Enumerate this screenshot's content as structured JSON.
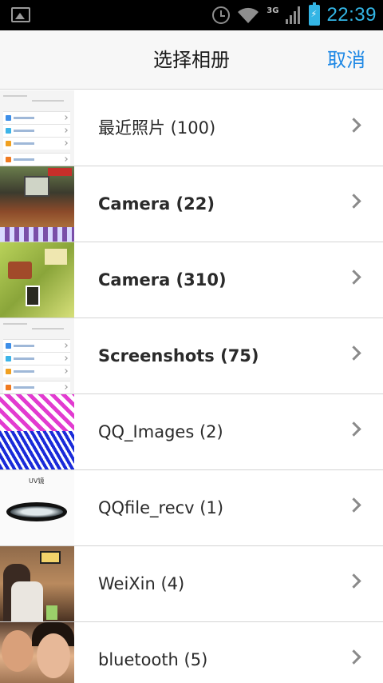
{
  "status_bar": {
    "network_type": "3G",
    "time": "22:39"
  },
  "header": {
    "title": "选择相册",
    "cancel_label": "取消"
  },
  "albums": [
    {
      "label": "最近照片 (100)",
      "thumbnail": "screenshot-thumbnail"
    },
    {
      "label": "Camera (22)",
      "thumbnail": "camera-photo-thumbnail"
    },
    {
      "label": "Camera (310)",
      "thumbnail": "camera-photo-thumbnail"
    },
    {
      "label": "Screenshots (75)",
      "thumbnail": "screenshot-thumbnail"
    },
    {
      "label": "QQ_Images (2)",
      "thumbnail": "pattern-thumbnail"
    },
    {
      "label": "QQfile_recv (1)",
      "thumbnail": "lens-filter-thumbnail"
    },
    {
      "label": "WeiXin (4)",
      "thumbnail": "person-photo-thumbnail"
    },
    {
      "label": "bluetooth (5)",
      "thumbnail": "selfie-photo-thumbnail"
    }
  ],
  "icons": {
    "row_arrow": "chevron-right-icon",
    "status_left": "image-notification-icon",
    "alarm": "alarm-clock-icon",
    "wifi": "wifi-icon",
    "signal": "cellular-signal-icon",
    "battery": "battery-charging-icon"
  },
  "colors": {
    "accent": "#1e88e5",
    "status_time": "#33b5e5"
  }
}
